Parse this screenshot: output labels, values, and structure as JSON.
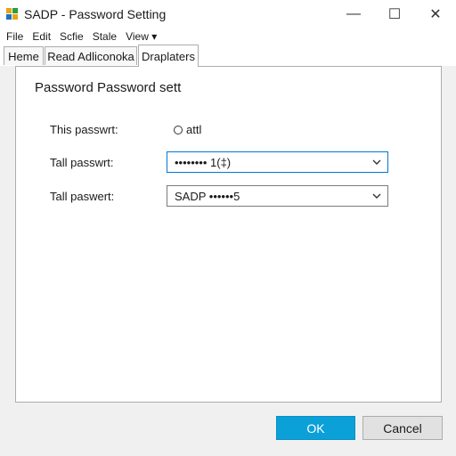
{
  "window": {
    "title": "SADP - Password Setting",
    "controls": {
      "minimize": "—",
      "maximize": "☐",
      "close": "✕"
    }
  },
  "menu": {
    "items": [
      "File",
      "Edit",
      "Scfie",
      "Stale",
      "View ▾"
    ]
  },
  "tabs": [
    {
      "label": "Heme",
      "active": false
    },
    {
      "label": "Read Adliconoka",
      "active": false
    },
    {
      "label": "Draplaters",
      "active": true
    }
  ],
  "panel": {
    "title": "Password Password sett",
    "rows": [
      {
        "label": "This passwrt:",
        "radio_label": "attl"
      },
      {
        "label": "Tall passwrt:",
        "combo_value": "•••••••• 1(‡)"
      },
      {
        "label": "Tall paswert:",
        "combo_value": "SADP ••••••5"
      }
    ]
  },
  "buttons": {
    "ok": "OK",
    "cancel": "Cancel"
  },
  "colors": {
    "accent": "#0ba0d8",
    "focus_border": "#0078d7"
  },
  "icons": {
    "app": "app-icon",
    "combo_arrow": "chevron-down-icon"
  }
}
